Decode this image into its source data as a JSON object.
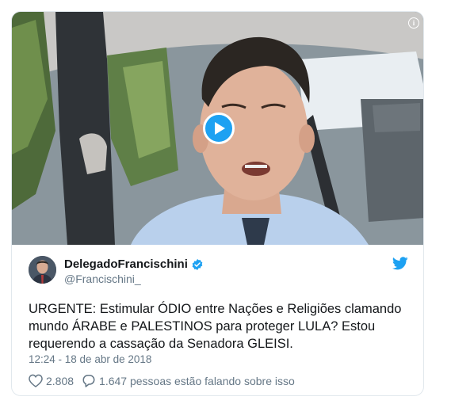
{
  "video": {
    "info_icon": "info-icon",
    "play_icon": "play-icon",
    "accent": "#1da1f2"
  },
  "tweet": {
    "display_name": "DelegadoFrancischini",
    "handle": "@Francischini_",
    "text": "URGENTE: Estimular ÓDIO entre Nações e Religiões clamando mundo ÁRABE e PALESTINOS para proteger LULA? Estou requerendo a cassação da Senadora GLEISI.",
    "timestamp": "12:24 - 18 de abr de 2018",
    "likes": "2.808",
    "conversation": "1.647 pessoas estão falando sobre isso",
    "verified_icon": "verified-badge-icon",
    "brand_icon": "twitter-bird-icon"
  },
  "colors": {
    "text": "#14171a",
    "secondary": "#657786",
    "brand": "#1da1f2",
    "border": "#e1e8ed"
  }
}
